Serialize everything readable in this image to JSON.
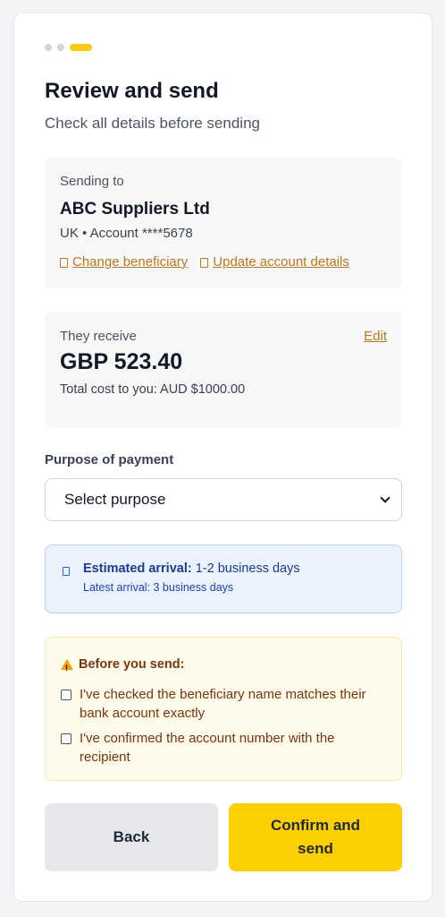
{
  "progress": {
    "steps": 3,
    "current": 3
  },
  "header": {
    "title": "Review and send",
    "subtitle": "Check all details before sending"
  },
  "recipient": {
    "label": "Sending to",
    "name": "ABC Suppliers Ltd",
    "account": "UK • Account ****5678",
    "change_link": "Change beneficiary",
    "update_link": "Update account details"
  },
  "receive": {
    "label": "They receive",
    "edit": "Edit",
    "amount": "GBP 523.40",
    "cost": "Total cost to you: AUD $1000.00"
  },
  "purpose": {
    "label": "Purpose of payment",
    "selected": "Select purpose"
  },
  "arrival": {
    "heading": "Estimated arrival:",
    "value": "1-2 business days",
    "latest": "Latest arrival: 3 business days"
  },
  "warning": {
    "heading": "Before you send:",
    "check1": "I've checked the beneficiary name matches their bank account exactly",
    "check2": "I've confirmed the account number with the recipient"
  },
  "actions": {
    "back": "Back",
    "confirm": "Confirm and send"
  },
  "colors": {
    "accent": "#fccf03",
    "link": "#b7791f",
    "info_bg": "#eaf2fd",
    "warn_bg": "#fefbea"
  }
}
